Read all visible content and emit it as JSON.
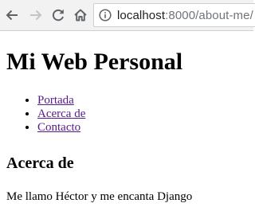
{
  "browser": {
    "url_host": "localhost",
    "url_rest": ":8000/about-me/",
    "icons": {
      "back": "arrow-left-icon",
      "forward": "arrow-right-icon",
      "reload": "reload-icon",
      "home": "home-icon",
      "site_info": "info-circle-icon"
    }
  },
  "page": {
    "heading": "Mi Web Personal",
    "menu": [
      {
        "label": "Portada"
      },
      {
        "label": "Acerca de"
      },
      {
        "label": "Contacto"
      }
    ],
    "section_title": "Acerca de",
    "about_text": "Me llamo Héctor y me encanta Django",
    "link_color": "#551a8b"
  }
}
